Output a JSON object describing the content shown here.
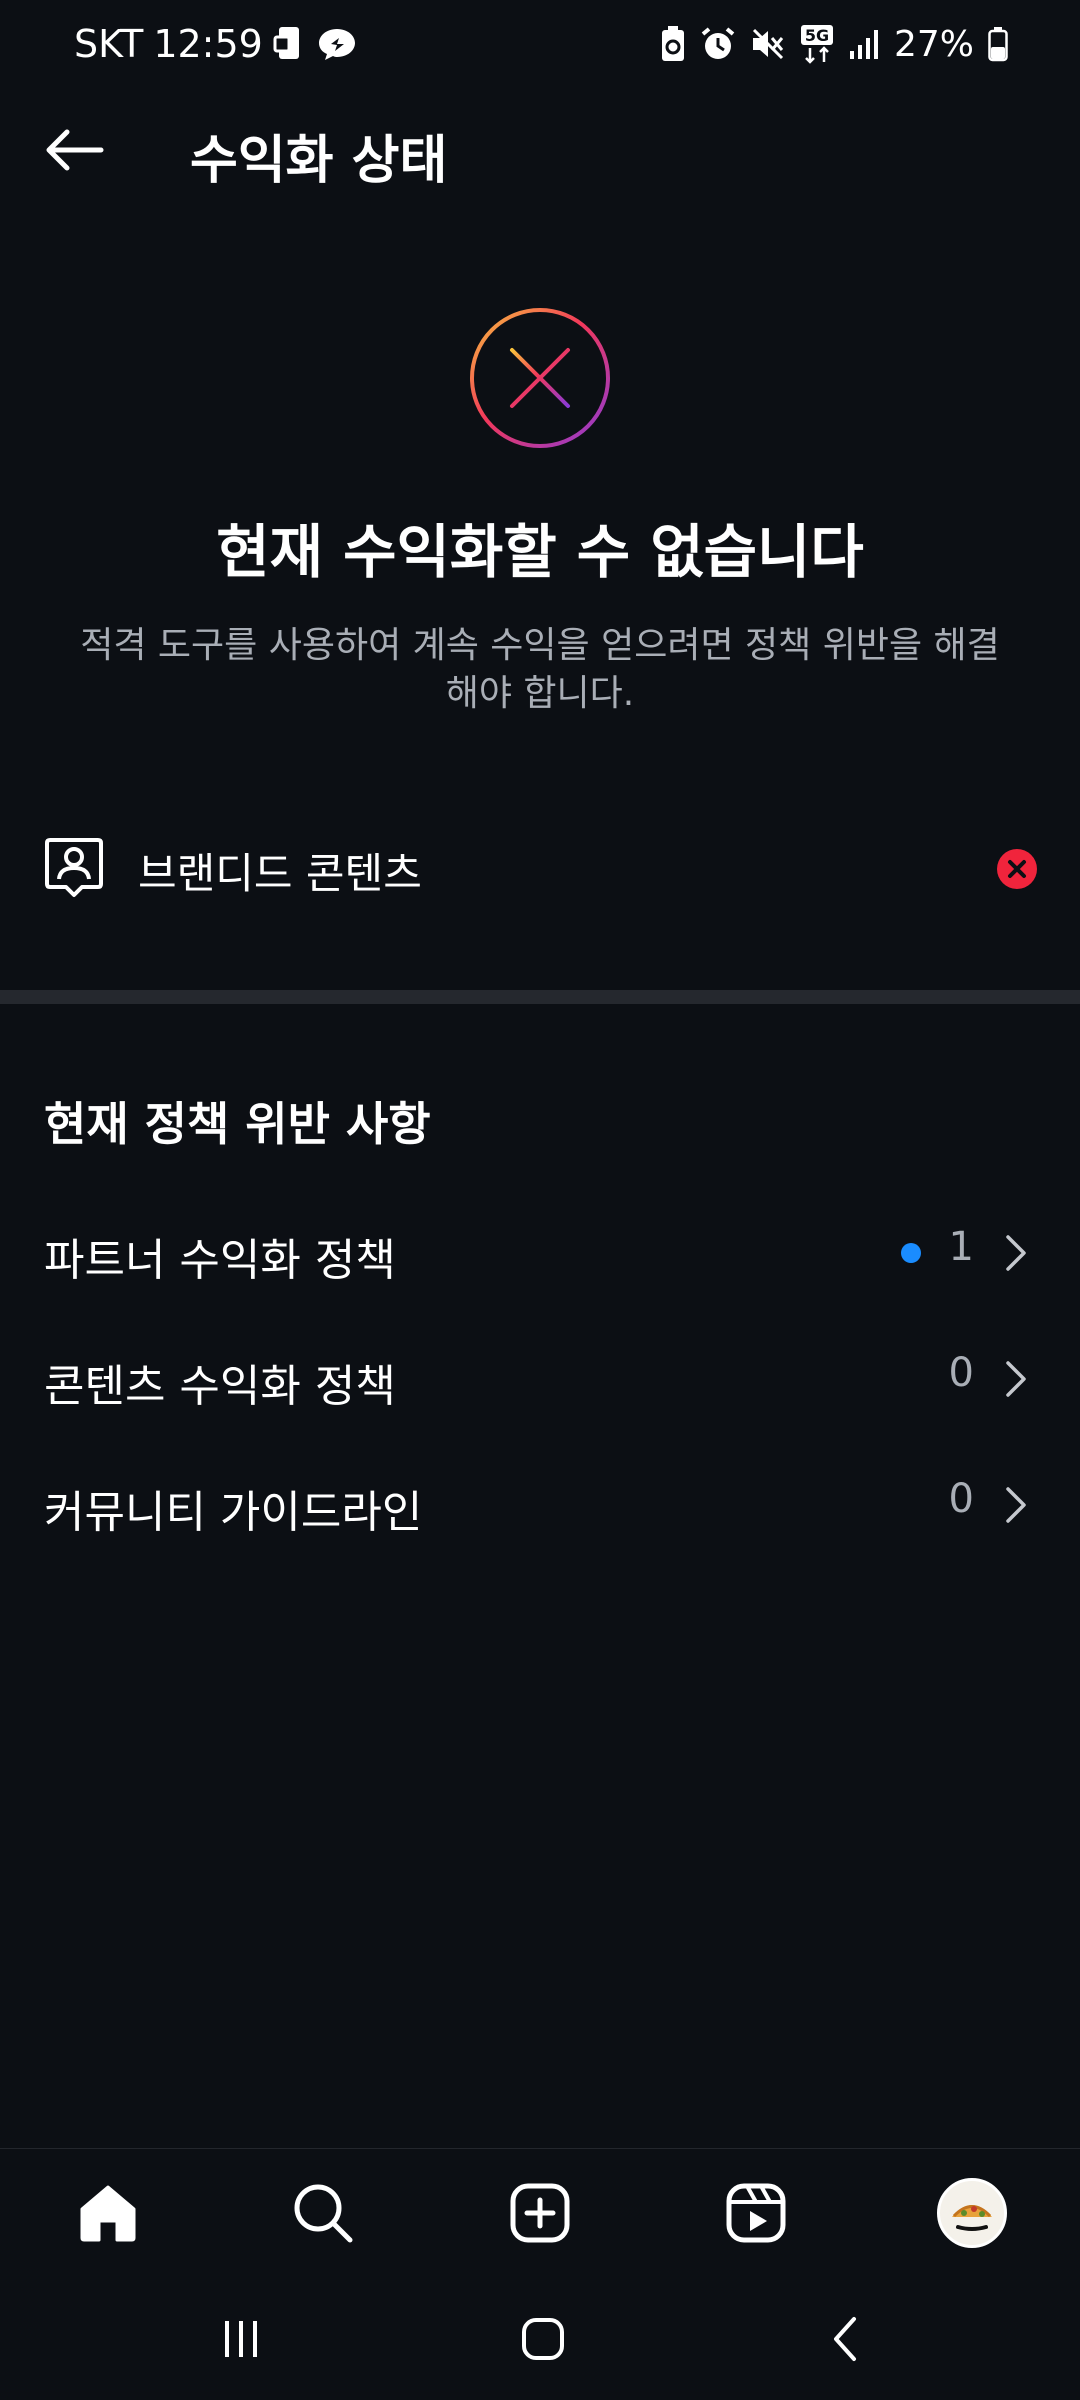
{
  "status_bar": {
    "carrier": "SKT",
    "time": "12:59",
    "network": "5G",
    "battery": "27%"
  },
  "header": {
    "title": "수익화 상태"
  },
  "hero": {
    "title": "현재 수익화할 수 없습니다",
    "description": "적격 도구를 사용하여 계속 수익을 얻으려면 정책 위반을 해결해야 합니다."
  },
  "tools": [
    {
      "label": "브랜디드 콘텐츠",
      "status": "ineligible",
      "status_color": "#f0243c"
    }
  ],
  "violations": {
    "section_title": "현재 정책 위반 사항",
    "items": [
      {
        "label": "파트너 수익화 정책",
        "count": "1",
        "has_new": true
      },
      {
        "label": "콘텐츠 수익화 정책",
        "count": "0",
        "has_new": false
      },
      {
        "label": "커뮤니티 가이드라인",
        "count": "0",
        "has_new": false
      }
    ]
  },
  "bottom_nav": {
    "items": [
      "home-icon",
      "search-icon",
      "create-icon",
      "reels-icon",
      "profile-avatar"
    ]
  },
  "colors": {
    "background": "#0c0f14",
    "divider": "#25282e",
    "muted_text": "#a9aeb6",
    "accent_blue": "#1a8cff",
    "error_red": "#f0243c"
  }
}
